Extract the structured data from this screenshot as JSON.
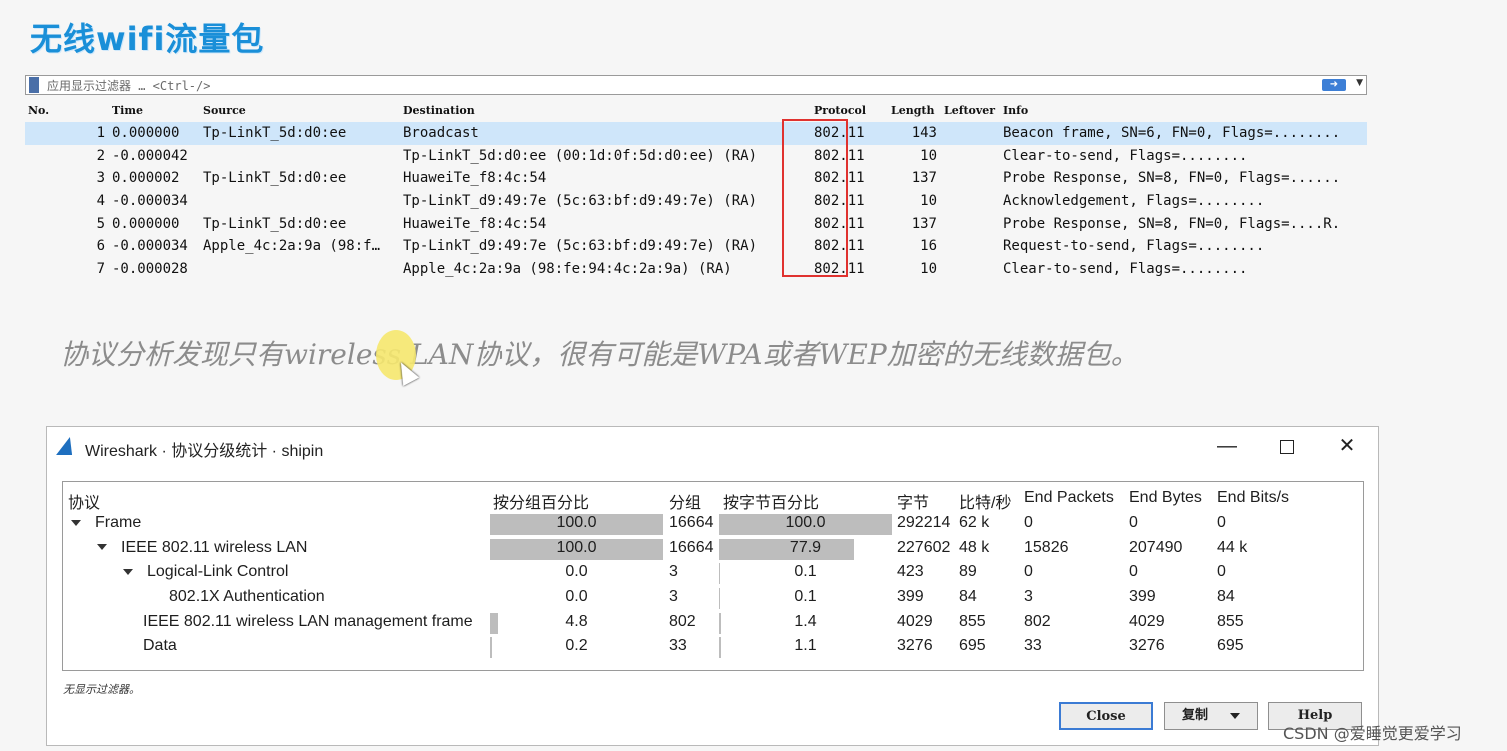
{
  "slide": {
    "title": "无线wifi流量包",
    "caption": "协议分析发现只有wireless LAN协议，很有可能是WPA或者WEP加密的无线数据包。",
    "watermark": "CSDN @爱睡觉更爱学习"
  },
  "filter": {
    "placeholder": "应用显示过滤器 … <Ctrl-/>",
    "apply_icon": "arrow-right-icon",
    "dropdown_icon": "chevron-down-icon"
  },
  "packet_list": {
    "headers": [
      "No.",
      "Time",
      "Source",
      "Destination",
      "Protocol",
      "Length",
      "Leftover",
      "Info"
    ],
    "rows": [
      {
        "no": "1",
        "time": "0.000000",
        "source": "Tp-LinkT_5d:d0:ee",
        "destination": "Broadcast",
        "protocol": "802.11",
        "length": "143",
        "info": "Beacon frame, SN=6, FN=0, Flags=........"
      },
      {
        "no": "2",
        "time": "-0.000042",
        "source": "",
        "destination": "Tp-LinkT_5d:d0:ee (00:1d:0f:5d:d0:ee) (RA)",
        "protocol": "802.11",
        "length": "10",
        "info": "Clear-to-send, Flags=........"
      },
      {
        "no": "3",
        "time": "0.000002",
        "source": "Tp-LinkT_5d:d0:ee",
        "destination": "HuaweiTe_f8:4c:54",
        "protocol": "802.11",
        "length": "137",
        "info": "Probe Response, SN=8, FN=0, Flags=......"
      },
      {
        "no": "4",
        "time": "-0.000034",
        "source": "",
        "destination": "Tp-LinkT_d9:49:7e (5c:63:bf:d9:49:7e) (RA)",
        "protocol": "802.11",
        "length": "10",
        "info": "Acknowledgement, Flags=........"
      },
      {
        "no": "5",
        "time": "0.000000",
        "source": "Tp-LinkT_5d:d0:ee",
        "destination": "HuaweiTe_f8:4c:54",
        "protocol": "802.11",
        "length": "137",
        "info": "Probe Response, SN=8, FN=0, Flags=....R."
      },
      {
        "no": "6",
        "time": "-0.000034",
        "source": "Apple_4c:2a:9a (98:f…",
        "destination": "Tp-LinkT_d9:49:7e (5c:63:bf:d9:49:7e) (RA)",
        "protocol": "802.11",
        "length": "16",
        "info": "Request-to-send, Flags=........"
      },
      {
        "no": "7",
        "time": "-0.000028",
        "source": "",
        "destination": "Apple_4c:2a:9a (98:fe:94:4c:2a:9a) (RA)",
        "protocol": "802.11",
        "length": "10",
        "info": "Clear-to-send, Flags=........"
      }
    ],
    "selected_row": 1,
    "highlight_color": "#e0322f"
  },
  "dialog": {
    "title": "Wireshark · 协议分级统计 · shipin",
    "icon": "wireshark-fin-icon",
    "window_buttons": {
      "minimize": "—",
      "close": "✕"
    },
    "headers": [
      "协议",
      "按分组百分比",
      "分组",
      "按字节百分比",
      "字节",
      "比特/秒",
      "End Packets",
      "End Bytes",
      "End Bits/s"
    ],
    "rows": [
      {
        "protocol": "Frame",
        "expanded": true,
        "pkt_pct": "100.0",
        "packets": "16664",
        "byte_pct": "100.0",
        "bytes": "292214",
        "bps": "62 k",
        "end_packets": "0",
        "end_bytes": "0",
        "end_bps": "0",
        "pkt_frac": 1.0,
        "byte_frac": 1.0
      },
      {
        "protocol": "IEEE 802.11 wireless LAN",
        "expanded": true,
        "pkt_pct": "100.0",
        "packets": "16664",
        "byte_pct": "77.9",
        "bytes": "227602",
        "bps": "48 k",
        "end_packets": "15826",
        "end_bytes": "207490",
        "end_bps": "44 k",
        "pkt_frac": 1.0,
        "byte_frac": 0.779
      },
      {
        "protocol": "Logical-Link Control",
        "expanded": true,
        "pkt_pct": "0.0",
        "packets": "3",
        "byte_pct": "0.1",
        "bytes": "423",
        "bps": "89",
        "end_packets": "0",
        "end_bytes": "0",
        "end_bps": "0",
        "pkt_frac": 0.0,
        "byte_frac": 0.001
      },
      {
        "protocol": "802.1X Authentication",
        "expanded": false,
        "pkt_pct": "0.0",
        "packets": "3",
        "byte_pct": "0.1",
        "bytes": "399",
        "bps": "84",
        "end_packets": "3",
        "end_bytes": "399",
        "end_bps": "84",
        "pkt_frac": 0.0,
        "byte_frac": 0.001
      },
      {
        "protocol": "IEEE 802.11 wireless LAN management frame",
        "expanded": false,
        "pkt_pct": "4.8",
        "packets": "802",
        "byte_pct": "1.4",
        "bytes": "4029",
        "bps": "855",
        "end_packets": "802",
        "end_bytes": "4029",
        "end_bps": "855",
        "pkt_frac": 0.048,
        "byte_frac": 0.014
      },
      {
        "protocol": "Data",
        "expanded": false,
        "pkt_pct": "0.2",
        "packets": "33",
        "byte_pct": "1.1",
        "bytes": "3276",
        "bps": "695",
        "end_packets": "33",
        "end_bytes": "3276",
        "end_bps": "695",
        "pkt_frac": 0.002,
        "byte_frac": 0.011
      }
    ],
    "status": "无显示过滤器。",
    "buttons": {
      "close": "Close",
      "copy": "复制",
      "help": "Help"
    }
  }
}
